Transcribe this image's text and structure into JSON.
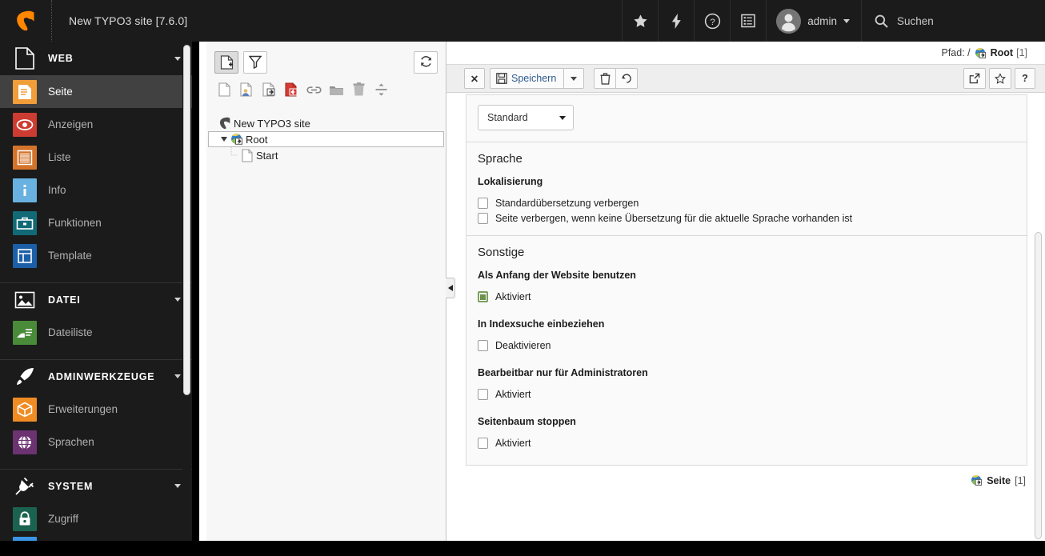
{
  "topbar": {
    "site_title": "New TYPO3 site [7.6.0]",
    "logo_name": "typo3-logo",
    "buttons": [
      {
        "name": "bookmarks-star-icon",
        "label": ""
      },
      {
        "name": "clear-cache-bolt-icon",
        "label": ""
      },
      {
        "name": "help-question-icon",
        "label": ""
      },
      {
        "name": "list-log-icon",
        "label": ""
      }
    ],
    "user": {
      "label": "admin",
      "avatar_name": "user-avatar"
    },
    "search": {
      "label": "Suchen",
      "placeholder": "Suchen"
    }
  },
  "sidebar": {
    "groups": [
      {
        "label": "WEB",
        "icon": "page-doc-icon",
        "items": [
          {
            "label": "Seite",
            "icon": "page-module-icon",
            "color": "#f19d3a",
            "active": true
          },
          {
            "label": "Anzeigen",
            "icon": "view-eye-icon",
            "color": "#cd3c32",
            "active": false
          },
          {
            "label": "Liste",
            "icon": "list-lines-icon",
            "color": "#d4742c",
            "active": false
          },
          {
            "label": "Info",
            "icon": "info-i-icon",
            "color": "#68b1e0",
            "active": false
          },
          {
            "label": "Funktionen",
            "icon": "functions-briefcase-icon",
            "color": "#116a76",
            "active": false
          },
          {
            "label": "Template",
            "icon": "template-layout-icon",
            "color": "#1b5fa8",
            "active": false
          }
        ]
      },
      {
        "label": "DATEI",
        "icon": "image-file-icon",
        "items": [
          {
            "label": "Dateiliste",
            "icon": "filelist-folder-icon",
            "color": "#4a8b3a",
            "active": false
          }
        ]
      },
      {
        "label": "ADMINWERKZEUGE",
        "icon": "rocket-icon",
        "items": [
          {
            "label": "Erweiterungen",
            "icon": "extension-box-icon",
            "color": "#ef8c23",
            "active": false
          },
          {
            "label": "Sprachen",
            "icon": "languages-globe-icon",
            "color": "#6c3372",
            "active": false
          }
        ]
      },
      {
        "label": "SYSTEM",
        "icon": "plug-icon",
        "items": [
          {
            "label": "Zugriff",
            "icon": "access-lock-icon",
            "color": "#1b6350",
            "active": false
          },
          {
            "label": "",
            "icon": "cut-off-module-icon",
            "color": "#3c94e6",
            "active": false
          }
        ]
      }
    ]
  },
  "tree": {
    "toolbar": {
      "new_page": "new-page-icon",
      "filter": "filter-funnel-icon",
      "refresh": "refresh-icon"
    },
    "drag_items": [
      "new-page-drag-icon",
      "new-page-user-drag-icon",
      "new-page-shortcut-drag-icon",
      "new-page-mountpoint-drag-icon",
      "new-link-drag-icon",
      "new-folder-drag-icon",
      "delete-trash-drag-icon",
      "new-separator-drag-icon"
    ],
    "nodes": [
      {
        "label": "New TYPO3 site",
        "icon": "typo3-site-root-icon",
        "depth": 0,
        "expandable": false,
        "selected": false
      },
      {
        "label": "Root",
        "icon": "globe-mountpoint-icon",
        "depth": 1,
        "expandable": true,
        "expanded": true,
        "selected": true
      },
      {
        "label": "Start",
        "icon": "page-white-icon",
        "depth": 2,
        "expandable": false,
        "selected": false
      }
    ]
  },
  "splitter": {
    "handle_icon": "collapse-left-triangle-icon"
  },
  "content": {
    "path_bar": {
      "prefix": "Pfad: /",
      "icon": "globe-mountpoint-icon",
      "page_name": "Root",
      "page_id": "[1]"
    },
    "toolbar": {
      "close_label": "✕",
      "close_name": "close-button",
      "save_label": "Speichern",
      "save_icon": "floppy-disk-icon",
      "save_dropdown_icon": "caret-down-icon",
      "delete_icon": "trash-icon",
      "undo_icon": "undo-history-icon",
      "open_in_new_icon": "open-in-new-window-icon",
      "bookmark_icon": "star-bookmark-icon",
      "help_label": "?",
      "help_icon": "help-question-icon"
    },
    "language_select": {
      "value": "Standard",
      "options": [
        "Standard"
      ]
    },
    "sections": [
      {
        "title": "Sprache",
        "fields": [
          {
            "label": "Lokalisierung",
            "checkboxes": [
              {
                "label": "Standardübersetzung verbergen",
                "checked": false
              },
              {
                "label": "Seite verbergen, wenn keine Übersetzung für die aktuelle Sprache vorhanden ist",
                "checked": false
              }
            ]
          }
        ]
      },
      {
        "title": "Sonstige",
        "fields": [
          {
            "label": "Als Anfang der Website benutzen",
            "checkboxes": [
              {
                "label": "Aktiviert",
                "checked": true
              }
            ]
          },
          {
            "label": "In Indexsuche einbeziehen",
            "checkboxes": [
              {
                "label": "Deaktivieren",
                "checked": false
              }
            ]
          },
          {
            "label": "Bearbeitbar nur für Administratoren",
            "checkboxes": [
              {
                "label": "Aktiviert",
                "checked": false
              }
            ]
          },
          {
            "label": "Seitenbaum stoppen",
            "checkboxes": [
              {
                "label": "Aktiviert",
                "checked": false
              }
            ]
          }
        ]
      }
    ],
    "footer": {
      "icon": "globe-mountpoint-icon",
      "label": "Seite",
      "id": "[1]"
    }
  },
  "colors": {
    "topbar_bg": "#1b1b1b",
    "sidebar_bg": "#1b1b1b",
    "sidebar_active": "#414141",
    "tree_bg": "#f7f7f7",
    "panel_bg": "#fafafa",
    "accent_orange": "#f49700",
    "checked_green": "#7ba05b"
  }
}
